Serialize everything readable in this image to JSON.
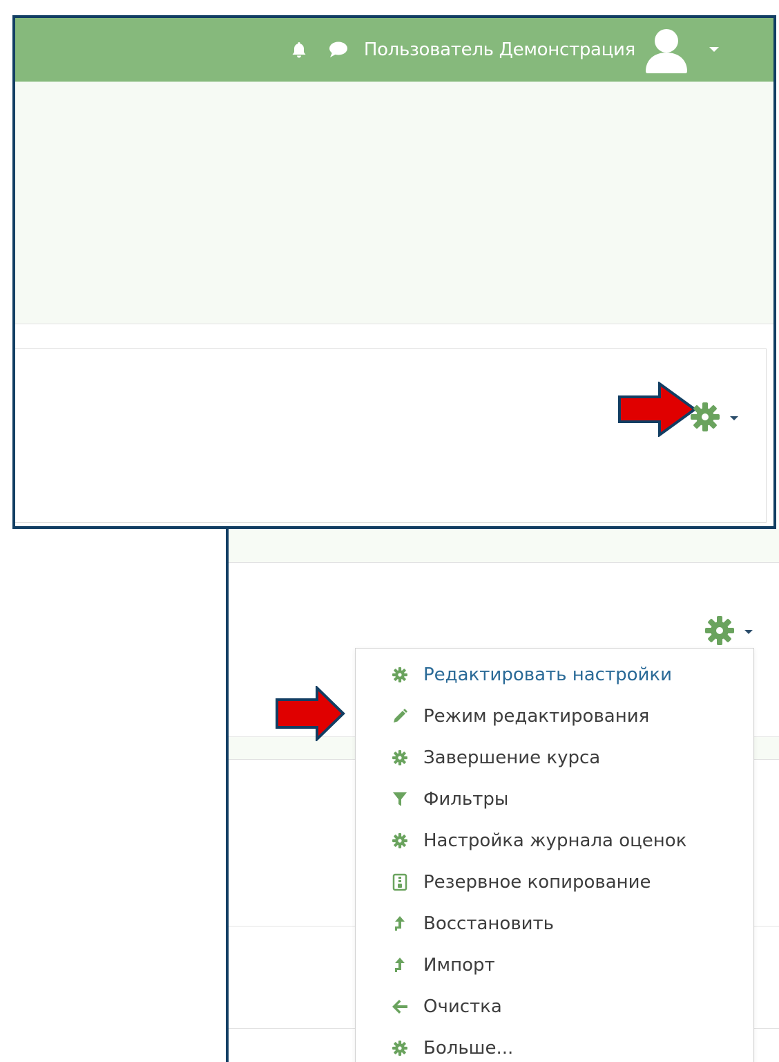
{
  "navbar": {
    "username": "Пользователь Демонстрация",
    "icons": [
      "bell-icon",
      "chat-icon",
      "avatar-icon",
      "caret-down-icon"
    ]
  },
  "colors": {
    "navbar": "#86b97c",
    "accent_green": "#6aa35e",
    "link_blue": "#2a6a97",
    "frame": "#123e63",
    "arrow_fill": "#e00000"
  },
  "settings_menu": {
    "trigger_icon": "gear-icon",
    "items": [
      {
        "label": "Редактировать настройки",
        "icon": "gear-icon"
      },
      {
        "label": "Режим редактирования",
        "icon": "pencil-icon"
      },
      {
        "label": "Завершение курса",
        "icon": "gear-icon"
      },
      {
        "label": "Фильтры",
        "icon": "filter-icon"
      },
      {
        "label": "Настройка журнала оценок",
        "icon": "gear-icon"
      },
      {
        "label": "Резервное копирование",
        "icon": "archive-icon"
      },
      {
        "label": "Восстановить",
        "icon": "upload-icon"
      },
      {
        "label": "Импорт",
        "icon": "upload-icon"
      },
      {
        "label": "Очистка",
        "icon": "arrow-left-icon"
      },
      {
        "label": "Больше...",
        "icon": "gear-icon"
      }
    ]
  }
}
